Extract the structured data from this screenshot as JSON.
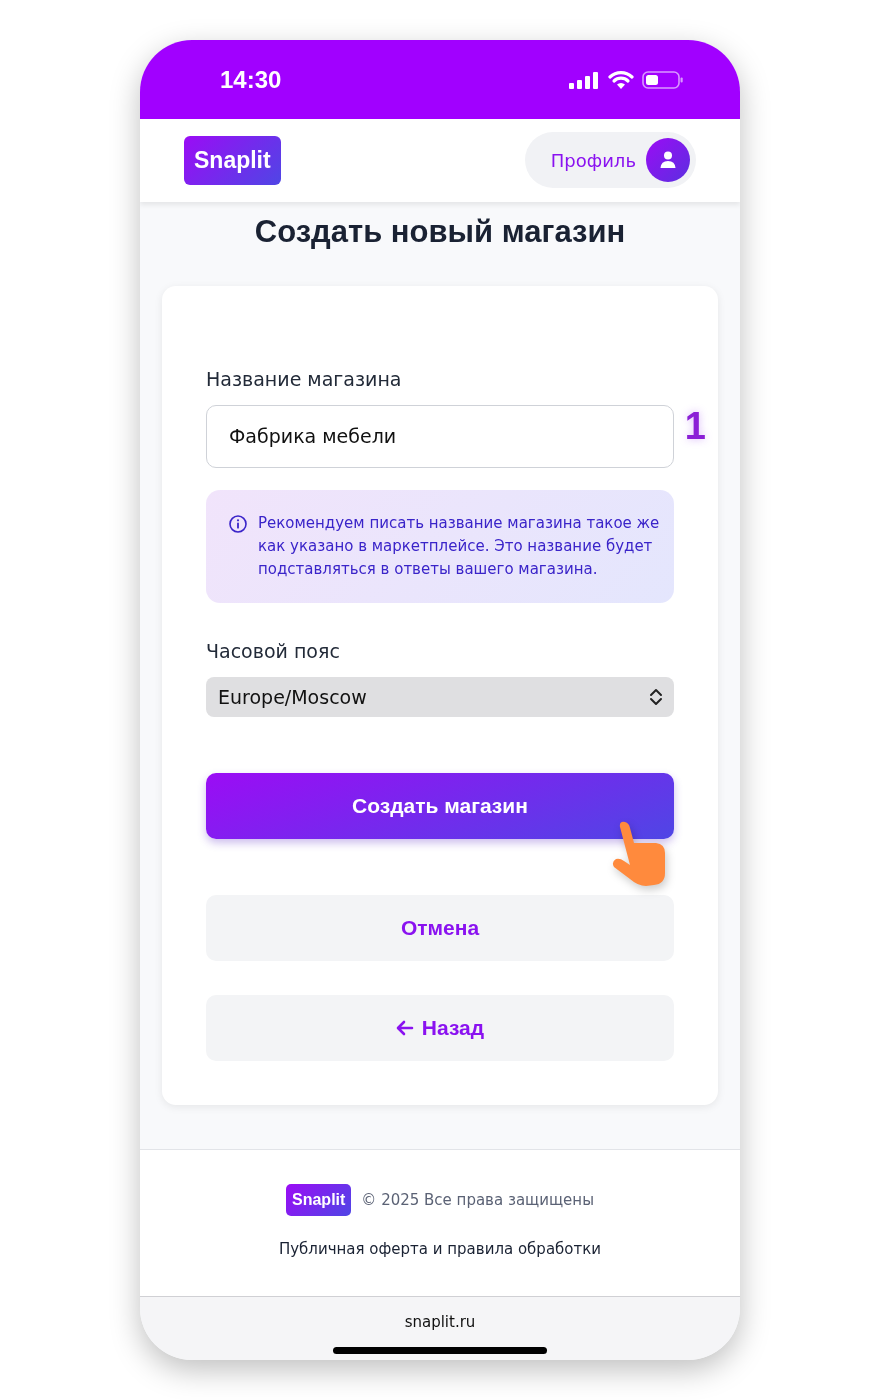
{
  "status_bar": {
    "time": "14:30"
  },
  "header": {
    "logo": "Snaplit",
    "profile_button": "Профиль"
  },
  "page_title": "Создать новый магазин",
  "form": {
    "name_label": "Название магазина",
    "name_value": "Фабрика мебели",
    "step_marker": "1",
    "info_note": "Рекомендуем писать название магазина такое же как указано в маркетплейсе. Это название будет подставляться в ответы вашего магазина.",
    "timezone_label": "Часовой пояс",
    "timezone_value": "Europe/Moscow",
    "buttons": [
      {
        "kind": "primary",
        "label": "Создать магазин"
      },
      {
        "kind": "secondary",
        "label": "Отмена"
      },
      {
        "kind": "back",
        "label": "Назад"
      }
    ]
  },
  "footer": {
    "logo": "Snaplit",
    "copyright": "© 2025 Все права защищены",
    "link": "Публичная оферта и правила обработки"
  },
  "browser_bar": {
    "url": "snaplit.ru"
  }
}
